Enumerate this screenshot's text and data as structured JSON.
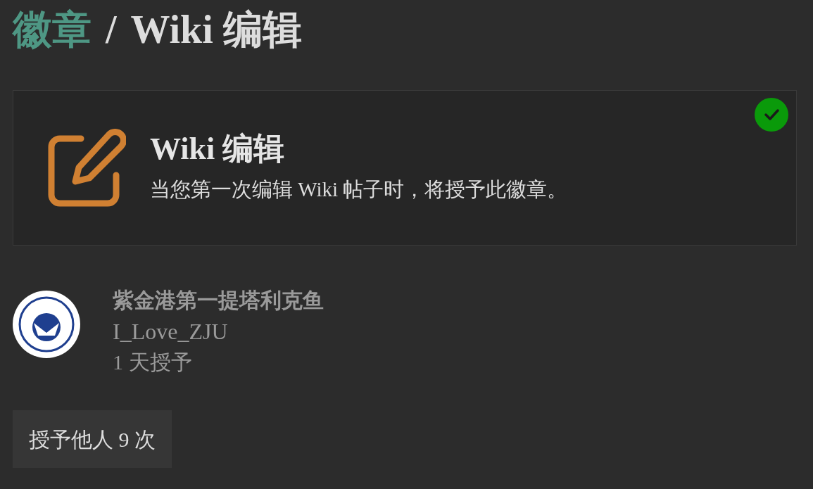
{
  "breadcrumb": {
    "parent": "徽章",
    "separator": "/",
    "current": "Wiki 编辑"
  },
  "badge": {
    "title": "Wiki 编辑",
    "description": "当您第一次编辑 Wiki 帖子时，将授予此徽章。",
    "granted": true
  },
  "grant": {
    "name": "紫金港第一提塔利克鱼",
    "username": "I_Love_ZJU",
    "time": "1 天授予"
  },
  "more_button": "授予他人 9 次"
}
